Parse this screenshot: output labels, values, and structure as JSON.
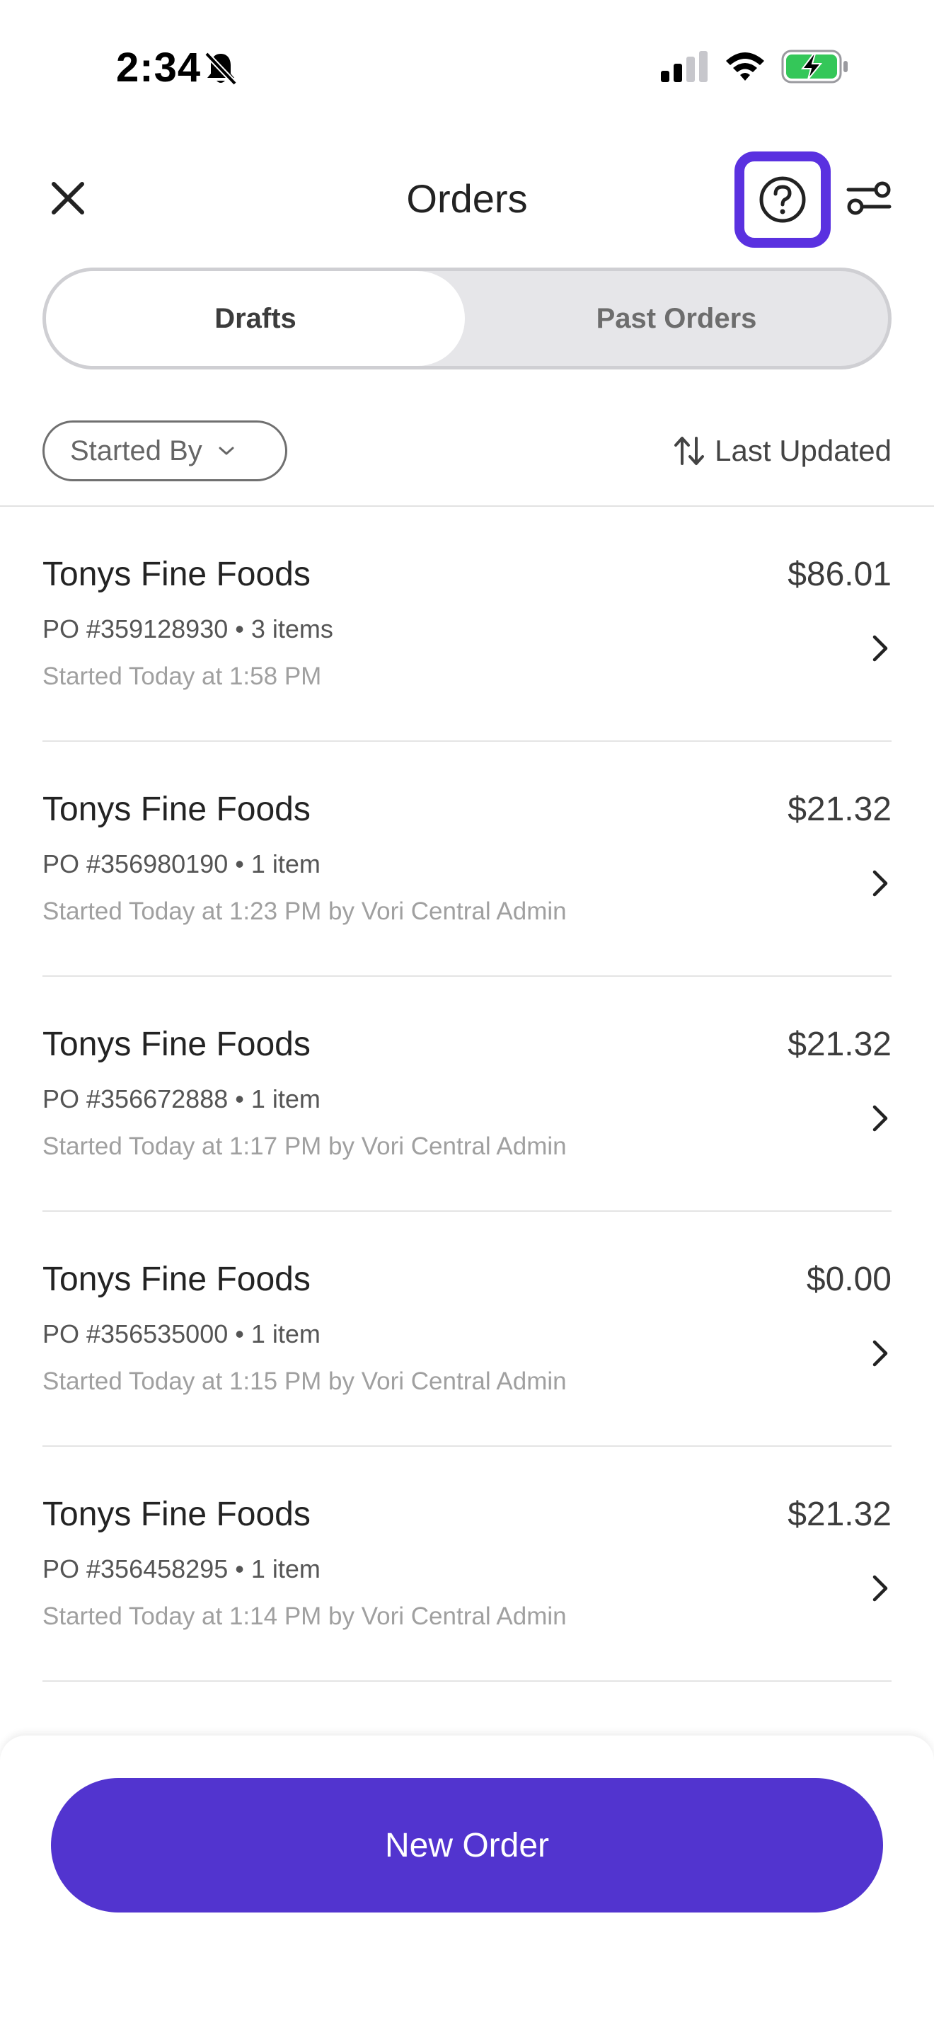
{
  "status_bar": {
    "time": "2:34"
  },
  "header": {
    "title": "Orders"
  },
  "tabs": [
    {
      "label": "Drafts",
      "active": true
    },
    {
      "label": "Past Orders",
      "active": false
    }
  ],
  "filters": {
    "started_by_label": "Started By",
    "sort_label": "Last Updated"
  },
  "orders": [
    {
      "vendor": "Tonys Fine Foods",
      "amount": "$86.01",
      "po": "PO #359128930 • 3 items",
      "started": "Started Today at 1:58 PM"
    },
    {
      "vendor": "Tonys Fine Foods",
      "amount": "$21.32",
      "po": "PO #356980190 • 1 item",
      "started": "Started Today at 1:23 PM by Vori Central Admin"
    },
    {
      "vendor": "Tonys Fine Foods",
      "amount": "$21.32",
      "po": "PO #356672888 • 1 item",
      "started": "Started Today at 1:17 PM by Vori Central Admin"
    },
    {
      "vendor": "Tonys Fine Foods",
      "amount": "$0.00",
      "po": "PO #356535000 • 1 item",
      "started": "Started Today at 1:15 PM by Vori Central Admin"
    },
    {
      "vendor": "Tonys Fine Foods",
      "amount": "$21.32",
      "po": "PO #356458295 • 1 item",
      "started": "Started Today at 1:14 PM by Vori Central Admin"
    }
  ],
  "footer": {
    "new_order_label": "New Order"
  },
  "colors": {
    "accent": "#5234cf",
    "highlight_border": "#5a31e0",
    "battery_green": "#34c759"
  },
  "icons": {
    "status": [
      "bell-slash-icon",
      "signal-icon",
      "wifi-icon",
      "battery-charging-icon"
    ],
    "header": [
      "close-icon",
      "help-icon",
      "filter-sliders-icon"
    ],
    "row": "chevron-right-icon",
    "sort": "sort-arrows-icon"
  }
}
